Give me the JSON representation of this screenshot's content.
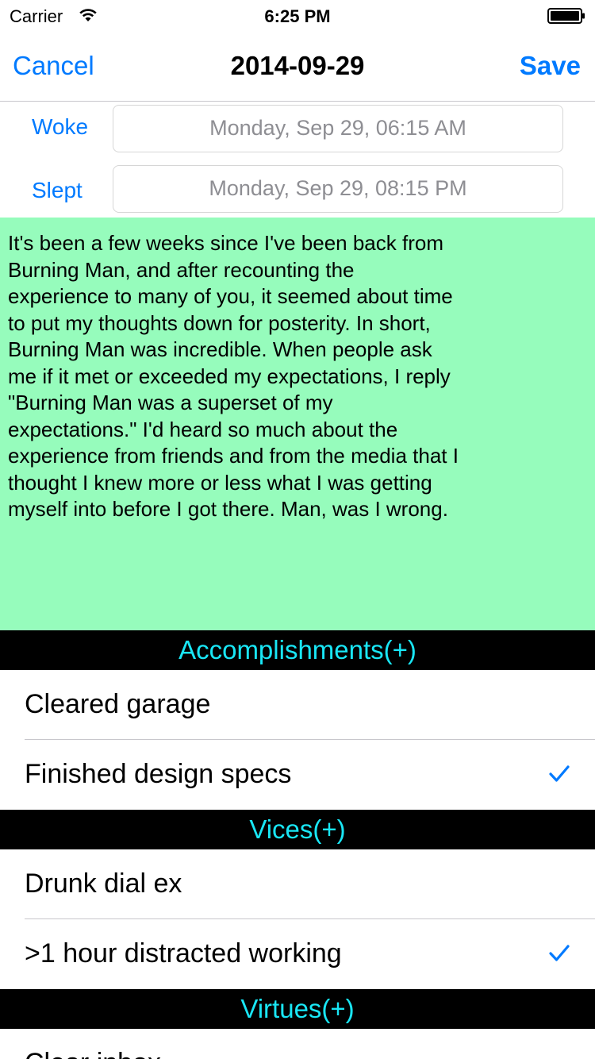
{
  "status_bar": {
    "carrier": "Carrier",
    "time": "6:25 PM"
  },
  "nav": {
    "cancel": "Cancel",
    "title": "2014-09-29",
    "save": "Save"
  },
  "times": {
    "woke_label": "Woke",
    "woke_value": "Monday, Sep 29, 06:15 AM",
    "slept_label": "Slept",
    "slept_value": "Monday, Sep 29, 08:15 PM"
  },
  "journal": {
    "text": "It's been a few weeks since I've been back from\nBurning Man, and after recounting the\nexperience to many of you, it seemed about time\nto put my thoughts down for posterity. In short,\nBurning Man was incredible. When people ask\nme if it met or exceeded my expectations, I reply\n\"Burning Man was a superset of my\nexpectations.\" I'd heard so much about the\nexperience from friends and from the media that I\nthought I knew more or less what I was getting\nmyself into before I got there. Man, was I wrong.",
    "background_color": "#96fcbc"
  },
  "sections": {
    "accomplishments": {
      "header": "Accomplishments(+)",
      "items": [
        {
          "label": "Cleared garage",
          "checked": false
        },
        {
          "label": "Finished design specs",
          "checked": true
        }
      ]
    },
    "vices": {
      "header": "Vices(+)",
      "items": [
        {
          "label": "Drunk dial ex",
          "checked": false
        },
        {
          "label": ">1 hour distracted working",
          "checked": true
        }
      ]
    },
    "virtues": {
      "header": "Virtues(+)",
      "items": [
        {
          "label": "Clear inbox",
          "checked": false
        }
      ]
    }
  },
  "colors": {
    "accent": "#007aff",
    "header_text": "#19e6f5",
    "header_background": "#000000",
    "journal_background": "#96fcbc"
  },
  "icons": {
    "wifi": "wifi-icon",
    "battery": "battery-icon",
    "check": "checkmark-icon"
  }
}
